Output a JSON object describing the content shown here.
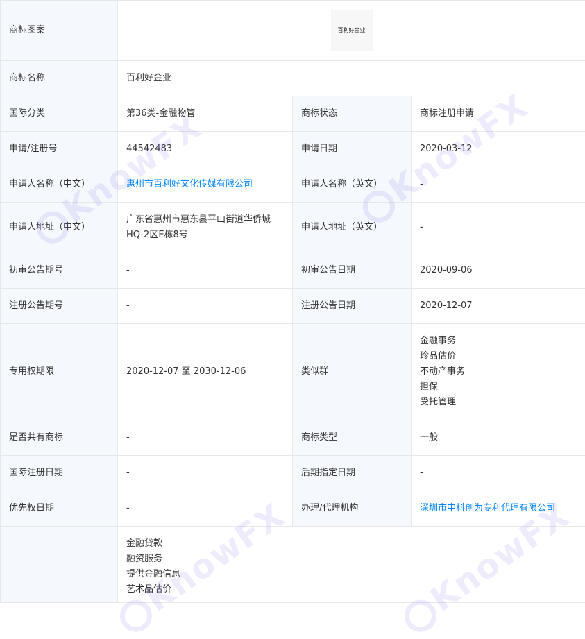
{
  "rows": {
    "logo": {
      "label": "商标图案",
      "logo_text": "百利好金业"
    },
    "name": {
      "label": "商标名称",
      "value": "百利好金业"
    },
    "class": {
      "label": "国际分类",
      "value": "第36类-金融物管",
      "label2": "商标状态",
      "value2": "商标注册申请"
    },
    "reg_no": {
      "label": "申请/注册号",
      "value": "44542483",
      "label2": "申请日期",
      "value2": "2020-03-12"
    },
    "applicant": {
      "label": "申请人名称（中文）",
      "value": "惠州市百利好文化传媒有限公司",
      "label2": "申请人名称（英文）",
      "value2": "-"
    },
    "address": {
      "label": "申请人地址（中文）",
      "value": "广东省惠州市惠东县平山街道华侨城HQ-2区E栋8号",
      "label2": "申请人地址（英文）",
      "value2": "-"
    },
    "prelim_no": {
      "label": "初审公告期号",
      "value": "-",
      "label2": "初审公告日期",
      "value2": "2020-09-06"
    },
    "reg_pub_no": {
      "label": "注册公告期号",
      "value": "-",
      "label2": "注册公告日期",
      "value2": "2020-12-07"
    },
    "term": {
      "label": "专用权期限",
      "value": "2020-12-07 至 2030-12-06",
      "label2": "类似群",
      "groups": [
        "金融事务",
        "珍品估价",
        "不动产事务",
        "担保",
        "受托管理"
      ]
    },
    "shared": {
      "label": "是否共有商标",
      "value": "-",
      "label2": "商标类型",
      "value2": "一般"
    },
    "intl_date": {
      "label": "国际注册日期",
      "value": "-",
      "label2": "后期指定日期",
      "value2": "-"
    },
    "priority": {
      "label": "优先权日期",
      "value": "-",
      "label2": "办理/代理机构",
      "value2": "深圳市中科创为专利代理有限公司"
    },
    "services": {
      "items": [
        "金融贷款",
        "融资服务",
        "提供金融信息",
        "艺术品估价"
      ]
    }
  },
  "watermark": {
    "text": "KnowFX"
  },
  "colors": {
    "link": "#0084ff",
    "label_bg": "#f5f8fc",
    "border": "#e8e8e8",
    "watermark": "#9682f0"
  }
}
